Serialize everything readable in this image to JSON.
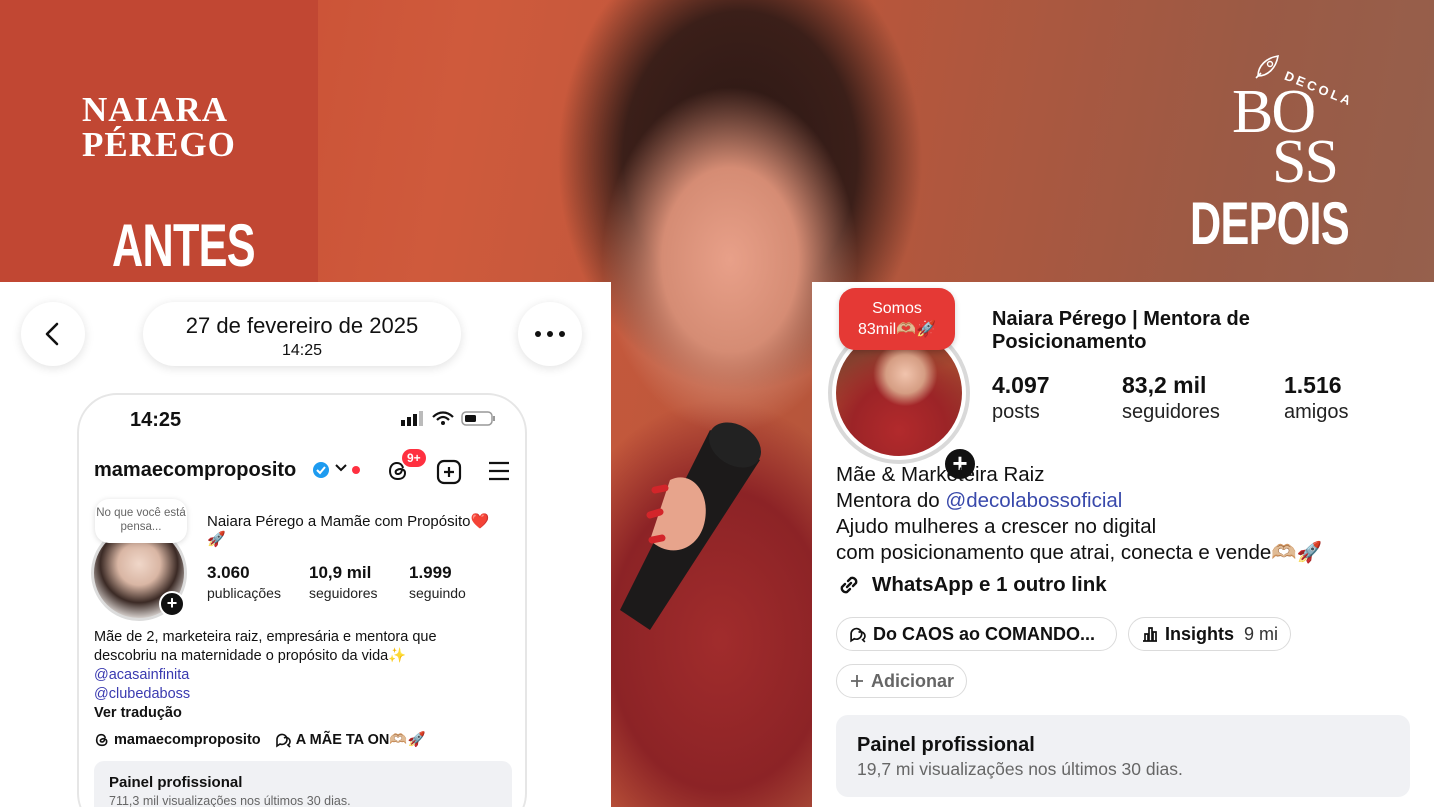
{
  "hero": {
    "name_line1": "NAIARA",
    "name_line2": "PÉREGO",
    "before_label": "ANTES",
    "after_label": "DEPOIS",
    "brand": {
      "top": "DECOLA",
      "line1": "BO",
      "line2": "SS"
    }
  },
  "before": {
    "date": "27 de fevereiro de 2025",
    "time": "14:25",
    "phone": {
      "clock": "14:25",
      "username": "mamaecomproposito",
      "notif_badge": "9+",
      "note": "No que você está pensa...",
      "full_name": "Naiara Pérego a Mamãe com Propósito❤️🚀",
      "stats": [
        {
          "value": "3.060",
          "label": "publicações"
        },
        {
          "value": "10,9 mil",
          "label": "seguidores"
        },
        {
          "value": "1.999",
          "label": "seguindo"
        }
      ],
      "bio_line1": "Mãe de 2, marketeira raiz, empresária e mentora que",
      "bio_line2": "descobriu na maternidade o propósito da vida✨",
      "mention1": "@acasainfinita",
      "mention2": "@clubedaboss",
      "translate": "Ver tradução",
      "threads_link": "mamaecomproposito",
      "channel_link": "A MÃE TA ON🫶🏼🚀",
      "panel_title": "Painel profissional",
      "panel_sub": "711,3 mil visualizações nos últimos 30 dias."
    }
  },
  "after": {
    "note_line1": "Somos",
    "note_line2": "83mil🫶🏼🚀",
    "full_name": "Naiara Pérego | Mentora de Posicionamento",
    "stats": [
      {
        "value": "4.097",
        "label": "posts"
      },
      {
        "value": "83,2 mil",
        "label": "seguidores"
      },
      {
        "value": "1.516",
        "label": "amigos"
      }
    ],
    "bio_line1": "Mãe & Marketeira Raiz",
    "bio_line2_prefix": "Mentora do ",
    "bio_mention": "@decolabossoficial",
    "bio_line3": "Ajudo mulheres a crescer no digital",
    "bio_line4": "com posicionamento que atrai, conecta e vende🫶🏼🚀",
    "link_text": "WhatsApp e 1 outro link",
    "chip_channel": "Do CAOS ao COMANDO...",
    "chip_insights": "Insights",
    "chip_insights_value": "9 mi",
    "chip_add": "Adicionar",
    "panel_title": "Painel profissional",
    "panel_sub": "19,7 mi visualizações nos últimos 30 dias."
  }
}
